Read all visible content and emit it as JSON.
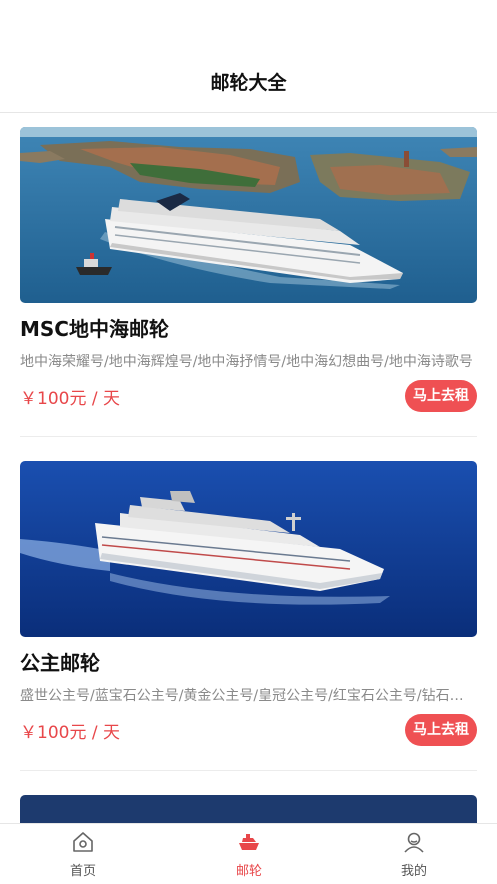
{
  "header": {
    "title": "邮轮大全"
  },
  "cards": [
    {
      "title": "MSC地中海邮轮",
      "subtitle": "地中海荣耀号/地中海辉煌号/地中海抒情号/地中海幻想曲号/地中海诗歌号",
      "price": "￥100元 / 天",
      "button": "马上去租"
    },
    {
      "title": "公主邮轮",
      "subtitle": "盛世公主号/蓝宝石公主号/黄金公主号/皇冠公主号/红宝石公主号/钻石公主号",
      "price": "￥100元 / 天",
      "button": "马上去租"
    }
  ],
  "tabbar": {
    "items": [
      {
        "label": "首页",
        "icon": "home-icon"
      },
      {
        "label": "邮轮",
        "icon": "ship-icon"
      },
      {
        "label": "我的",
        "icon": "user-icon"
      }
    ],
    "active_color": "#e8474a"
  }
}
